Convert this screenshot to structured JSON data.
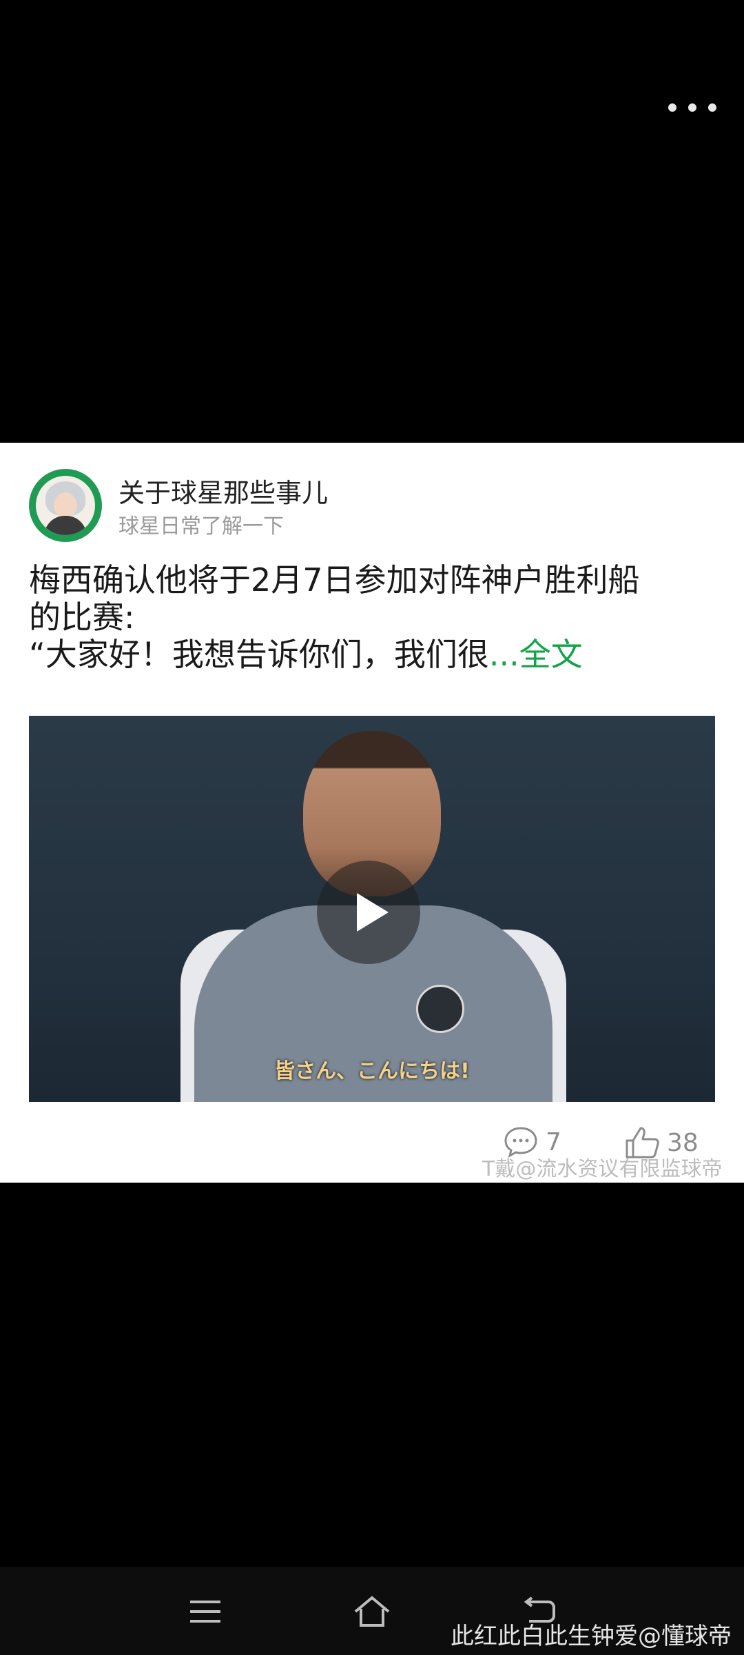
{
  "post": {
    "author_name": "关于球星那些事儿",
    "author_subtitle": "球星日常了解一下",
    "text_line1": "梅西确认他将于2月7日参加对阵神户胜利船",
    "text_line2": "的比赛:",
    "text_line3": "“大家好！我想告诉你们，我们很",
    "more_link": "...全文",
    "video_subtitle": "皆さん、こんにちは!",
    "comment_count": "7",
    "like_count": "38",
    "watermark_mid": "T戴@流水资议有限监球帝"
  },
  "watermark_bottom": "此红此白此生钟爱@懂球帝",
  "icons": {
    "more": "more-dots-icon",
    "comment": "comment-bubble-icon",
    "like": "thumbs-up-icon",
    "nav_menu": "menu-icon",
    "nav_home": "home-icon",
    "nav_back": "back-icon"
  },
  "colors": {
    "link": "#13a34a",
    "subtitle": "#f4d28a"
  }
}
